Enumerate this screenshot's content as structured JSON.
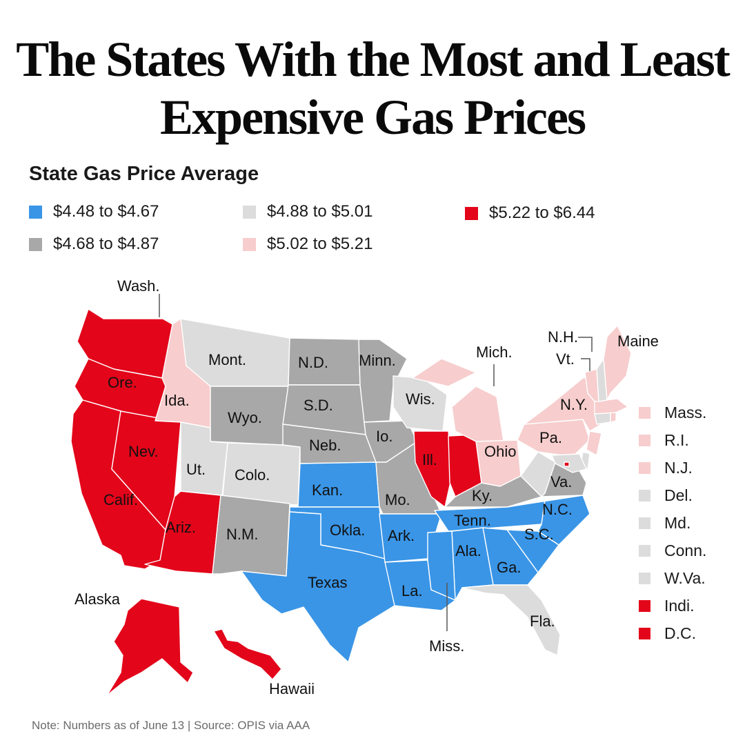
{
  "title": {
    "line1": "The States With the Most and Least",
    "line2": "Expensive Gas Prices"
  },
  "legend": {
    "title": "State Gas Price Average",
    "items": [
      {
        "label": "$4.48 to $4.67",
        "color": "#3a95e6"
      },
      {
        "label": "$4.68 to $4.87",
        "color": "#a8a8a8"
      },
      {
        "label": "$4.88 to $5.01",
        "color": "#dcdcdc"
      },
      {
        "label": "$5.02 to $5.21",
        "color": "#f7cdcd"
      },
      {
        "label": "$5.22 to $6.44",
        "color": "#e3051a"
      }
    ]
  },
  "map": {
    "labels": {
      "wash": "Wash.",
      "ore": "Ore.",
      "calif": "Calif.",
      "nev": "Nev.",
      "ida": "Ida.",
      "mont": "Mont.",
      "wyo": "Wyo.",
      "ut": "Ut.",
      "colo": "Colo.",
      "ariz": "Ariz.",
      "nm": "N.M.",
      "nd": "N.D.",
      "sd": "S.D.",
      "neb": "Neb.",
      "kan": "Kan.",
      "okla": "Okla.",
      "texas": "Texas",
      "minn": "Minn.",
      "io": "Io.",
      "mo": "Mo.",
      "ark": "Ark.",
      "la": "La.",
      "wis": "Wis.",
      "ill": "Ill.",
      "mich": "Mich.",
      "ohio": "Ohio",
      "ky": "Ky.",
      "tenn": "Tenn.",
      "miss": "Miss.",
      "ala": "Ala.",
      "ga": "Ga.",
      "fla": "Fla.",
      "sc": "S.C.",
      "nc": "N.C.",
      "va": "Va.",
      "pa": "Pa.",
      "ny": "N.Y.",
      "vt": "Vt.",
      "nh": "N.H.",
      "maine": "Maine",
      "alaska": "Alaska",
      "hawaii": "Hawaii"
    },
    "small_states": [
      {
        "label": "Mass.",
        "color": "#f7cdcd"
      },
      {
        "label": "R.I.",
        "color": "#f7cdcd"
      },
      {
        "label": "N.J.",
        "color": "#f7cdcd"
      },
      {
        "label": "Del.",
        "color": "#dcdcdc"
      },
      {
        "label": "Md.",
        "color": "#dcdcdc"
      },
      {
        "label": "Conn.",
        "color": "#dcdcdc"
      },
      {
        "label": "W.Va.",
        "color": "#dcdcdc"
      },
      {
        "label": "Indi.",
        "color": "#e3051a"
      },
      {
        "label": "D.C.",
        "color": "#e3051a"
      }
    ]
  },
  "note": "Note: Numbers as of June 13 | Source: OPIS via AAA"
}
